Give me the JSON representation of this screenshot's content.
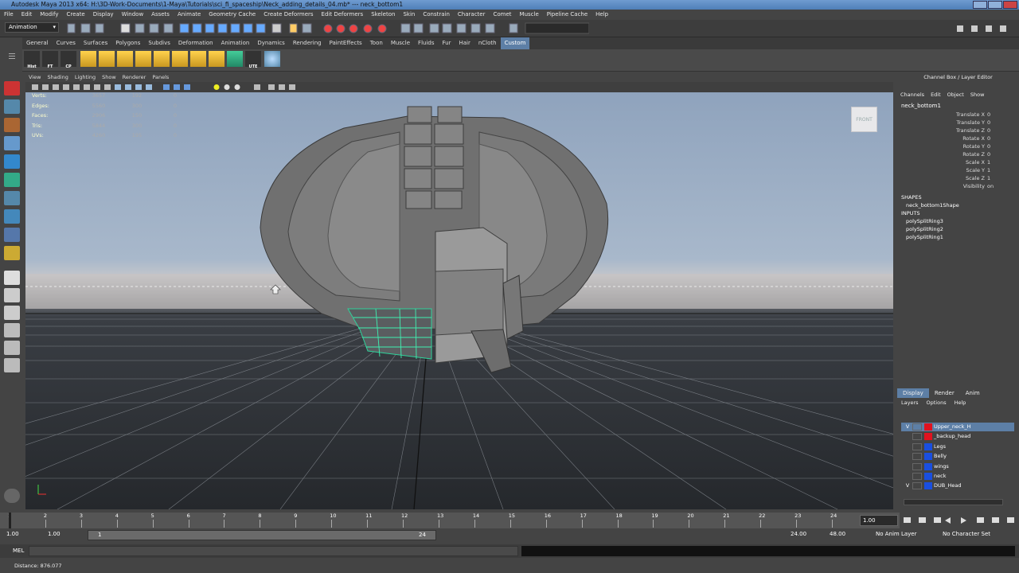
{
  "window": {
    "title": "Autodesk Maya 2013 x64: H:\\3D-Work-Documents\\1-Maya\\Tutorials\\sci_fi_spaceship\\Neck_adding_details_04.mb*   ---   neck_bottom1"
  },
  "menubar": [
    "File",
    "Edit",
    "Modify",
    "Create",
    "Display",
    "Window",
    "Assets",
    "Animate",
    "Geometry Cache",
    "Create Deformers",
    "Edit Deformers",
    "Skeleton",
    "Skin",
    "Constrain",
    "Character",
    "Comet",
    "Muscle",
    "Pipeline Cache",
    "Help"
  ],
  "statusline": {
    "menu_set": "Animation"
  },
  "shelf_tabs": [
    "General",
    "Curves",
    "Surfaces",
    "Polygons",
    "Subdivs",
    "Deformation",
    "Animation",
    "Dynamics",
    "Rendering",
    "PaintEffects",
    "Toon",
    "Muscle",
    "Fluids",
    "Fur",
    "Hair",
    "nCloth",
    "Custom"
  ],
  "shelf_active_tab": "Custom",
  "shelf_labels": [
    "Hist",
    "FT",
    "CP",
    "UTE"
  ],
  "viewport_menu": [
    "View",
    "Shading",
    "Lighting",
    "Show",
    "Renderer",
    "Panels"
  ],
  "hud": [
    {
      "label": "Verts:",
      "a": "3657",
      "b": "192",
      "c": "0"
    },
    {
      "label": "Edges:",
      "a": "5560",
      "b": "300",
      "c": "0"
    },
    {
      "label": "Faces:",
      "a": "2906",
      "b": "150",
      "c": "0"
    },
    {
      "label": "Tris:",
      "a": "5844",
      "b": "300",
      "c": "0"
    },
    {
      "label": "UVs:",
      "a": "4260",
      "b": "195",
      "c": "0"
    }
  ],
  "view_cube": "FRONT",
  "channel_box": {
    "header": "Channel Box / Layer Editor",
    "menu": [
      "Channels",
      "Edit",
      "Object",
      "Show"
    ],
    "object": "neck_bottom1",
    "attributes": [
      {
        "name": "Translate X",
        "value": "0"
      },
      {
        "name": "Translate Y",
        "value": "0"
      },
      {
        "name": "Translate Z",
        "value": "0"
      },
      {
        "name": "Rotate X",
        "value": "0"
      },
      {
        "name": "Rotate Y",
        "value": "0"
      },
      {
        "name": "Rotate Z",
        "value": "0"
      },
      {
        "name": "Scale X",
        "value": "1"
      },
      {
        "name": "Scale Y",
        "value": "1"
      },
      {
        "name": "Scale Z",
        "value": "1"
      },
      {
        "name": "Visibility",
        "value": "on"
      }
    ],
    "shapes_label": "SHAPES",
    "shape": "neck_bottom1Shape",
    "inputs_label": "INPUTS",
    "inputs": [
      "polySplitRing3",
      "polySplitRing2",
      "polySplitRing1"
    ]
  },
  "layer_editor": {
    "tabs": [
      "Display",
      "Render",
      "Anim"
    ],
    "menu": [
      "Layers",
      "Options",
      "Help"
    ],
    "layers": [
      {
        "vis": "V",
        "name": "Upper_neck_H",
        "color": "#e0131f",
        "selected": true
      },
      {
        "vis": "",
        "name": "_backup_head",
        "color": "#e0131f",
        "selected": false
      },
      {
        "vis": "",
        "name": "Legs",
        "color": "#1a4fe0",
        "selected": false
      },
      {
        "vis": "",
        "name": "Belly",
        "color": "#1a4fe0",
        "selected": false
      },
      {
        "vis": "",
        "name": "wings",
        "color": "#1a4fe0",
        "selected": false
      },
      {
        "vis": "",
        "name": "neck",
        "color": "#1a4fe0",
        "selected": false
      },
      {
        "vis": "V",
        "name": "DUB_Head",
        "color": "#1a4fe0",
        "selected": false
      }
    ]
  },
  "timeline": {
    "ticks": [
      "1",
      "2",
      "3",
      "4",
      "5",
      "6",
      "7",
      "8",
      "9",
      "10",
      "11",
      "12",
      "13",
      "14",
      "15",
      "16",
      "17",
      "18",
      "19",
      "20",
      "21",
      "22",
      "23",
      "24"
    ],
    "current_frame": "1.00"
  },
  "range": {
    "start": "1.00",
    "start2": "1.00",
    "slider_start": "1",
    "slider_end": "24",
    "end": "24.00",
    "end2": "48.00",
    "anim_layer": "No Anim Layer",
    "char_set": "No Character Set"
  },
  "cmdline": {
    "label": "MEL"
  },
  "helpline": {
    "text": "Distance:  876.077"
  }
}
